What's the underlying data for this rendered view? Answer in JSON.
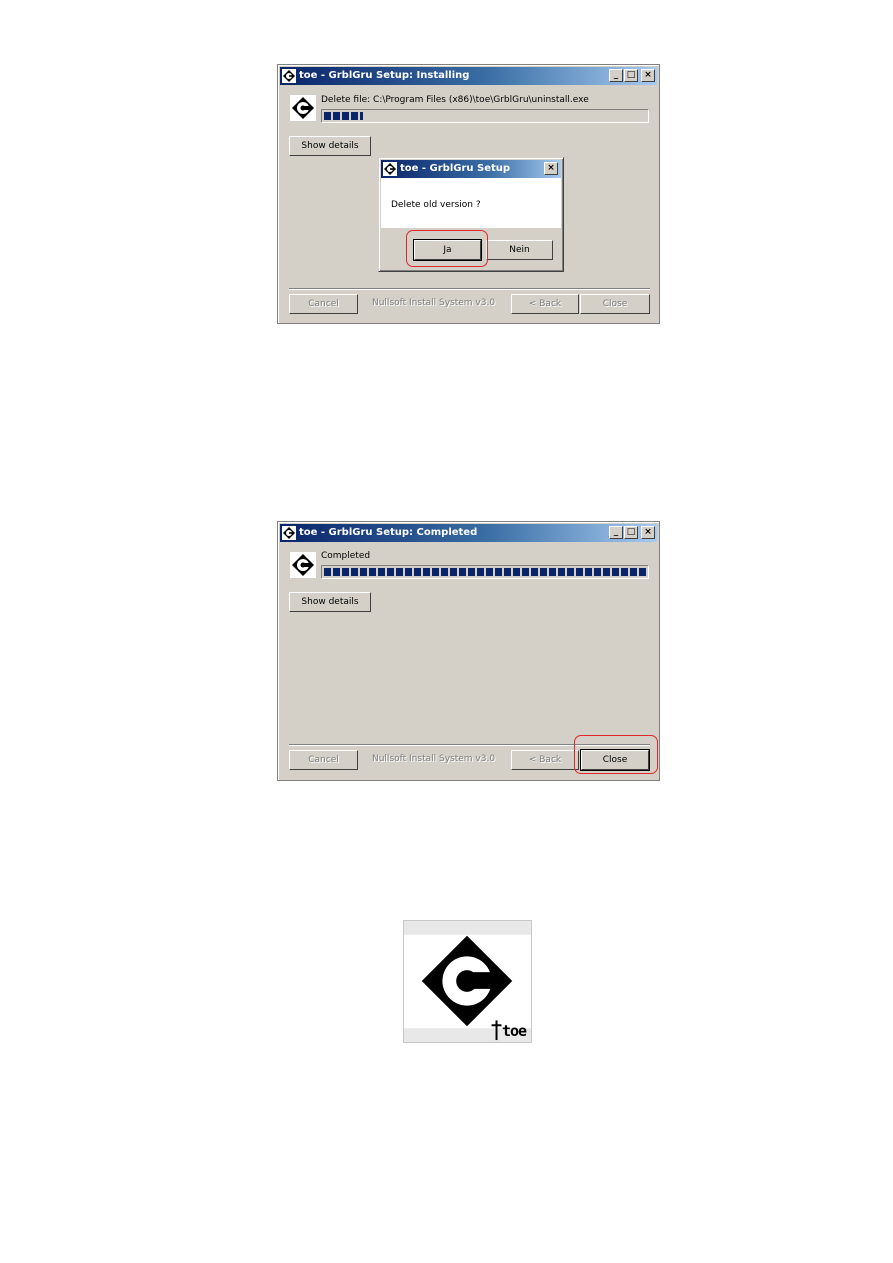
{
  "installing_window": {
    "title": "toe - GrblGru Setup: Installing",
    "status_text": "Delete file: C:\\Program Files (x86)\\toe\\GrblGru\\uninstall.exe",
    "progress_fraction": 0.12,
    "show_details_label": "Show details",
    "cancel_label": "Cancel",
    "branding": "Nullsoft Install System v3.0",
    "back_label": "< Back",
    "close_label": "Close"
  },
  "confirm_dialog": {
    "title": "toe - GrblGru Setup",
    "message": "Delete old version ?",
    "yes_label": "Ja",
    "no_label": "Nein"
  },
  "completed_window": {
    "title": "toe - GrblGru Setup: Completed",
    "status_text": "Completed",
    "progress_fraction": 1.0,
    "show_details_label": "Show details",
    "cancel_label": "Cancel",
    "branding": "Nullsoft Install System v3.0",
    "back_label": "< Back",
    "close_label": "Close"
  },
  "big_logo": {
    "text": "toe"
  },
  "colors": {
    "titlebar_start": "#0a246a",
    "titlebar_end": "#a6caf0",
    "window_bg": "#d4d0c8",
    "highlight": "#e0262f"
  }
}
